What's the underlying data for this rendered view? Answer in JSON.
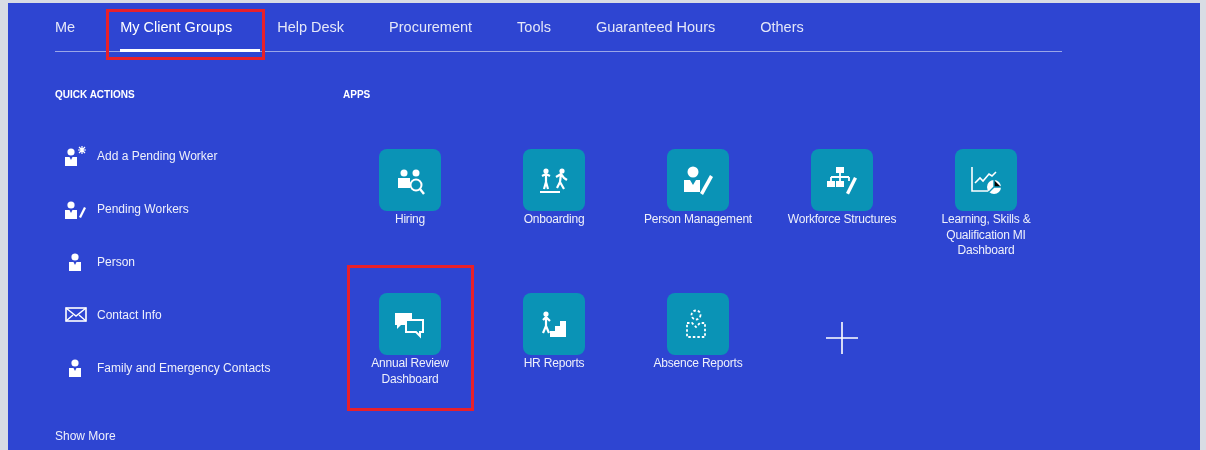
{
  "tabs": [
    {
      "label": "Me",
      "selected": false,
      "highlighted": false
    },
    {
      "label": "My Client Groups",
      "selected": true,
      "highlighted": true
    },
    {
      "label": "Help Desk",
      "selected": false,
      "highlighted": false
    },
    {
      "label": "Procurement",
      "selected": false,
      "highlighted": false
    },
    {
      "label": "Tools",
      "selected": false,
      "highlighted": false
    },
    {
      "label": "Guaranteed Hours",
      "selected": false,
      "highlighted": false
    },
    {
      "label": "Others",
      "selected": false,
      "highlighted": false
    }
  ],
  "quick_actions": {
    "heading": "QUICK ACTIONS",
    "items": [
      {
        "label": "Add a Pending Worker"
      },
      {
        "label": "Pending Workers"
      },
      {
        "label": "Person"
      },
      {
        "label": "Contact Info"
      },
      {
        "label": "Family and Emergency Contacts"
      }
    ],
    "show_more": "Show More"
  },
  "apps": {
    "heading": "APPS",
    "items": [
      {
        "label": "Hiring",
        "highlighted": false
      },
      {
        "label": "Onboarding",
        "highlighted": false
      },
      {
        "label": "Person Management",
        "highlighted": false
      },
      {
        "label": "Workforce Structures",
        "highlighted": false
      },
      {
        "label": "Learning, Skills & Qualification MI Dashboard",
        "highlighted": false
      },
      {
        "label": "Annual Review Dashboard",
        "highlighted": true
      },
      {
        "label": "HR Reports",
        "highlighted": false
      },
      {
        "label": "Absence Reports",
        "highlighted": false
      }
    ]
  }
}
